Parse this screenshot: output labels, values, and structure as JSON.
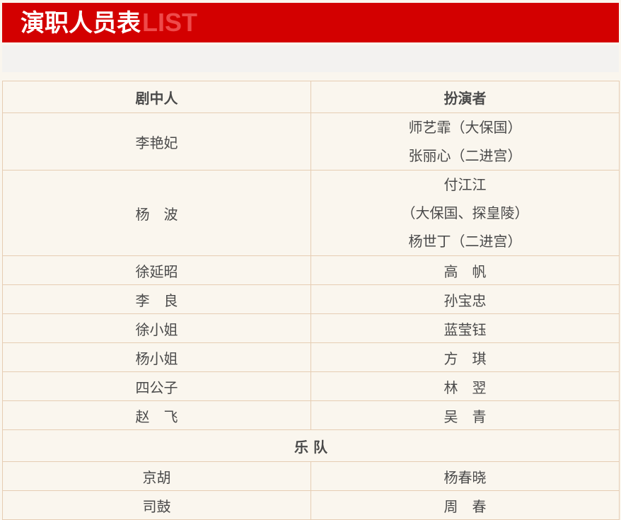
{
  "header": {
    "title": "演职人员表",
    "title_en": "LIST"
  },
  "table": {
    "headers": [
      "剧中人",
      "扮演者"
    ],
    "rows": [
      {
        "role": "李艳妃",
        "actors": [
          "师艺霏（大保国）",
          "张丽心（二进宫）"
        ]
      },
      {
        "role": "杨　波",
        "actors": [
          "付江江",
          "（大保国、探皇陵）",
          "杨世丁（二进宫）"
        ]
      },
      {
        "role": "徐延昭",
        "actors": [
          "高　帆"
        ]
      },
      {
        "role": "李　良",
        "actors": [
          "孙宝忠"
        ]
      },
      {
        "role": "徐小姐",
        "actors": [
          "蓝莹钰"
        ]
      },
      {
        "role": "杨小姐",
        "actors": [
          "方　琪"
        ]
      },
      {
        "role": "四公子",
        "actors": [
          "林　翌"
        ]
      },
      {
        "role": "赵　飞",
        "actors": [
          "吴　青"
        ]
      }
    ],
    "section_title": "乐 队",
    "band": [
      {
        "role": "京胡",
        "actor": "杨春晓"
      },
      {
        "role": "司鼓",
        "actor": "周　春"
      }
    ]
  }
}
